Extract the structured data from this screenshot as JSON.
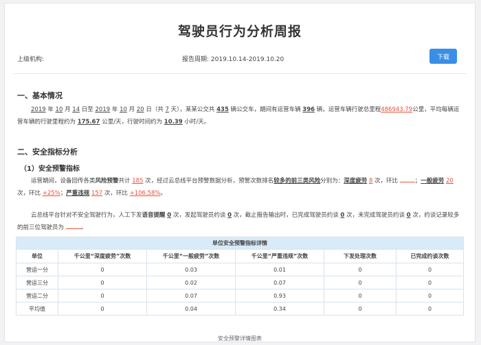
{
  "header": {
    "title": "驾驶员行为分析周报",
    "org_label": "上级机构:",
    "period_label": "报告周期:",
    "period_value": "2019.10.14-2019.10.20",
    "download_label": "下载"
  },
  "section1": {
    "heading": "一、基本情况",
    "start_year": "2019",
    "start_month": "10",
    "start_day": "14",
    "end_year": "2019",
    "end_month": "10",
    "end_day": "20",
    "days": "7",
    "company_text": "某某公交共",
    "bus_count": "435",
    "operating_count": "396",
    "total_mileage": "486943.79",
    "avg_mileage": "175.67",
    "avg_hours": "10.39"
  },
  "section2": {
    "heading": "二、安全指标分析",
    "sub_heading": "（1）安全预警指标",
    "warning_total": "185",
    "deep_fatigue_label": "深度疲劳",
    "deep_fatigue_count": "8",
    "general_fatigue_label": "一般疲劳",
    "general_fatigue_count": "20",
    "general_fatigue_change": "+25%",
    "serious_label": "严重违规",
    "serious_count": "157",
    "serious_change": "+106.58%",
    "voice_alerts": "0",
    "interviews_initiated": "0",
    "interviews_completed": "0",
    "interviews_pending": "0"
  },
  "table": {
    "caption": "单位安全预警指标详情",
    "headers": [
      "单位",
      "千公里“深度疲劳”次数",
      "千公里“一般疲劳”次数",
      "千公里“严重违规”次数",
      "下发处理次数",
      "已完成约谈次数"
    ],
    "rows": [
      [
        "营运一分",
        "0",
        "0.03",
        "0.01",
        "0",
        "0"
      ],
      [
        "营运三分",
        "0",
        "0.02",
        "0.07",
        "0",
        "0"
      ],
      [
        "营运二分",
        "0",
        "0.07",
        "0.93",
        "0",
        "0"
      ],
      [
        "平均值",
        "0",
        "0.04",
        "0.34",
        "0",
        "0"
      ]
    ]
  },
  "footer": {
    "chart_caption": "安全预警详情图表"
  }
}
